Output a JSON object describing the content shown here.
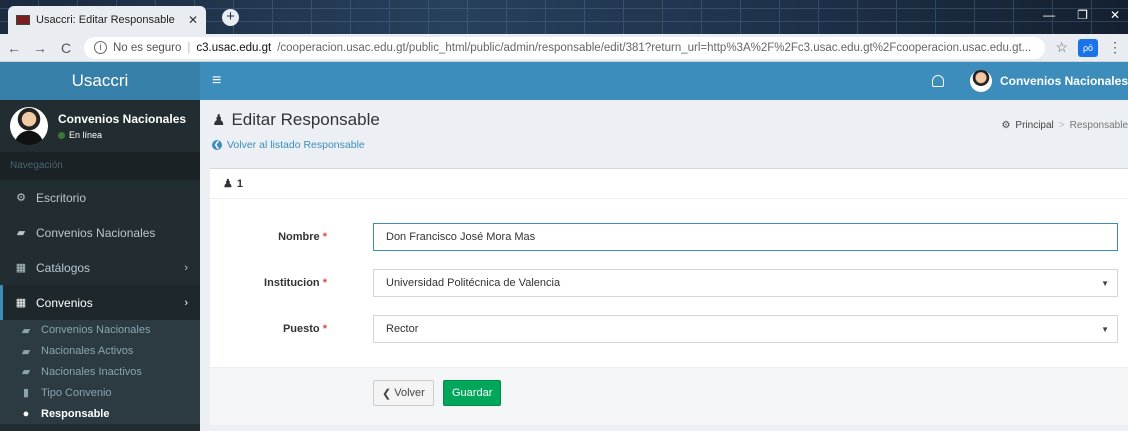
{
  "browser": {
    "tab_title": "Usaccri: Editar Responsable",
    "tab_close": "✕",
    "new_tab": "+",
    "window_controls": [
      "—",
      "❐",
      "✕"
    ],
    "back": "←",
    "forward": "→",
    "reload": "C",
    "security_label": "No es seguro",
    "url_host": "c3.usac.edu.gt",
    "url_path": "/cooperacion.usac.edu.gt/public_html/public/admin/responsable/edit/381?return_url=http%3A%2F%2Fc3.usac.edu.gt%2Fcooperacion.usac.edu.gt...",
    "star": "☆",
    "extension": "ρō",
    "menu": "⋮"
  },
  "header": {
    "logo": "Usaccri",
    "hamburger": "≡",
    "user_name": "Convenios Nacionales"
  },
  "sidebar": {
    "user_name": "Convenios Nacionales",
    "user_status": "En línea",
    "nav_header": "Navegación",
    "items": [
      {
        "label": "Escritorio",
        "icon": "⚙"
      },
      {
        "label": "Convenios Nacionales",
        "icon": "▰"
      },
      {
        "label": "Catálogos",
        "icon": "▦",
        "chevron": "›"
      },
      {
        "label": "Convenios",
        "icon": "▦",
        "chevron": "›"
      }
    ],
    "sub_items": [
      {
        "label": "Convenios Nacionales",
        "icon": "▰"
      },
      {
        "label": "Nacionales Activos",
        "icon": "▰"
      },
      {
        "label": "Nacionales Inactivos",
        "icon": "▰"
      },
      {
        "label": "Tipo Convenio",
        "icon": "▮"
      },
      {
        "label": "Responsable",
        "icon": "●"
      }
    ]
  },
  "content": {
    "title": "Editar Responsable",
    "back_link": "Volver al listado Responsable",
    "breadcrumb": {
      "home": "Principal",
      "separator": ">",
      "current": "Responsable"
    },
    "box_title": "1",
    "form": {
      "nombre_label": "Nombre",
      "nombre_value": "Don Francisco José Mora Mas",
      "institucion_label": "Institucion",
      "institucion_value": "Universidad Politécnica de Valencia",
      "puesto_label": "Puesto",
      "puesto_value": "Rector",
      "required_mark": "*",
      "dropdown_caret": "▼"
    },
    "buttons": {
      "back": "Volver",
      "save": "Guardar"
    }
  }
}
